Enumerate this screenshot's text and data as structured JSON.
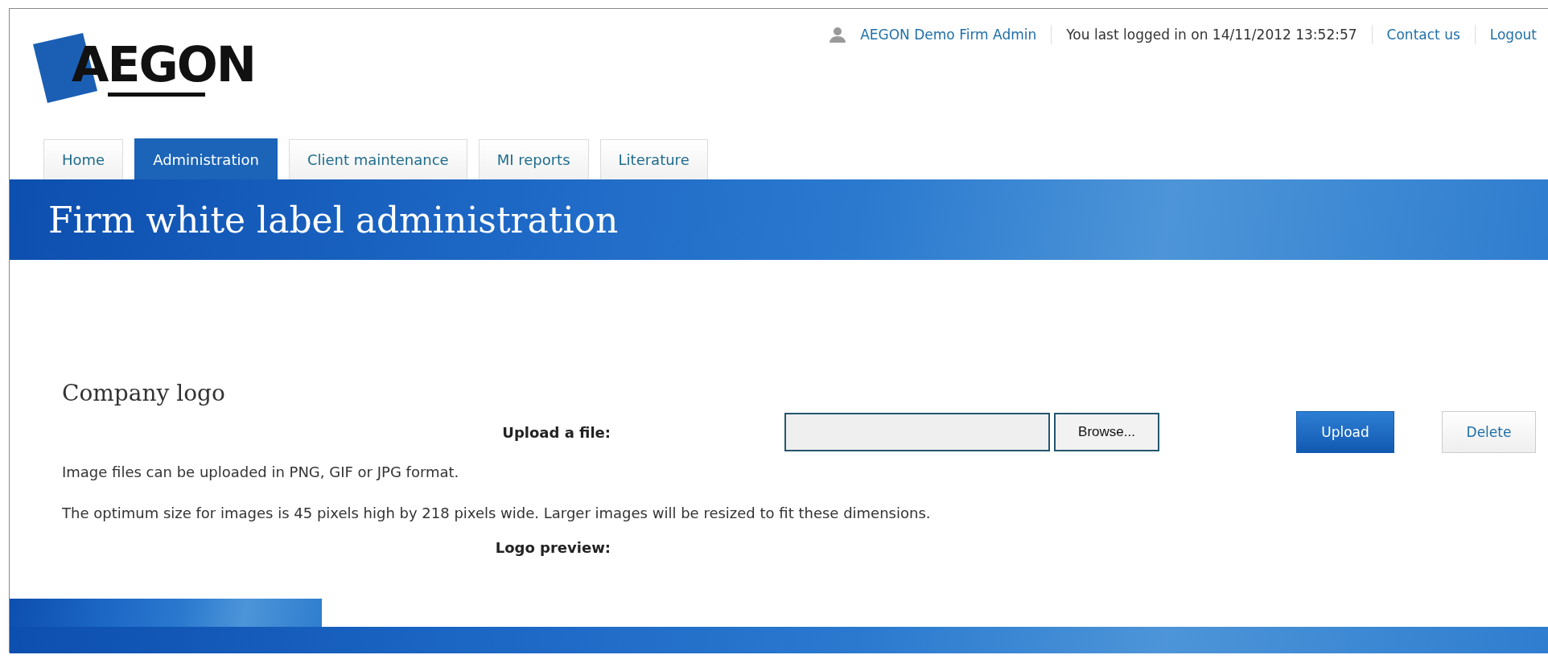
{
  "logo": {
    "text": "AEGON"
  },
  "user_bar": {
    "user": "AEGON Demo Firm Admin",
    "last_login": "You last logged in on 14/11/2012 13:52:57",
    "links": [
      "Contact us",
      "Logout"
    ]
  },
  "tabs": [
    {
      "label": "Home",
      "selected": false
    },
    {
      "label": "Administration",
      "selected": true
    },
    {
      "label": "Client maintenance",
      "selected": false
    },
    {
      "label": "MI reports",
      "selected": false
    },
    {
      "label": "Literature",
      "selected": false
    }
  ],
  "banner": {
    "title": "Firm white label administration"
  },
  "section": {
    "title": "Company logo",
    "upload_label": "Upload a file:",
    "browse_button": "Browse...",
    "buttons": [
      {
        "label": "Upload",
        "kind": "primary"
      },
      {
        "label": "Delete",
        "kind": "secondary"
      }
    ],
    "notes": [
      "Image files can be uploaded in PNG, GIF or JPG format.",
      "The optimum size for images is 45 pixels high by 218 pixels wide. Larger images will be resized to fit these dimensions."
    ],
    "preview_label": "Logo preview:"
  }
}
